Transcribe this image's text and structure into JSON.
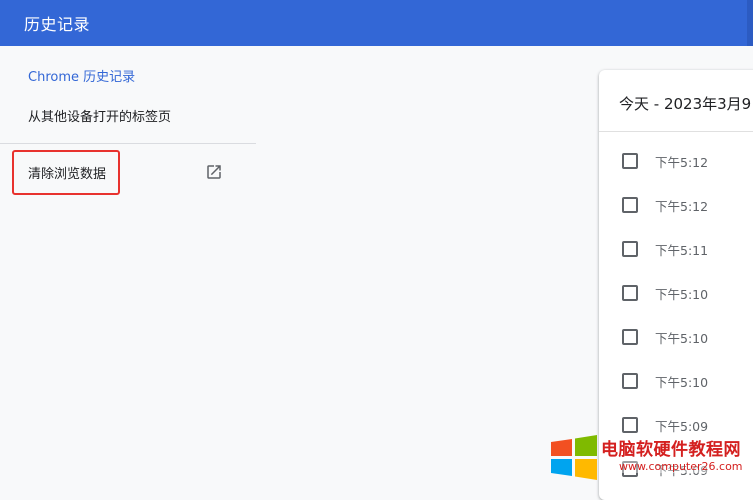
{
  "header": {
    "title": "历史记录"
  },
  "sidebar": {
    "items": [
      {
        "label": "Chrome 历史记录"
      },
      {
        "label": "从其他设备打开的标签页"
      },
      {
        "label": "清除浏览数据"
      }
    ]
  },
  "history": {
    "date_header": "今天 - 2023年3月9",
    "entries": [
      {
        "time": "下午5:12"
      },
      {
        "time": "下午5:12"
      },
      {
        "time": "下午5:11"
      },
      {
        "time": "下午5:10"
      },
      {
        "time": "下午5:10"
      },
      {
        "time": "下午5:10"
      },
      {
        "time": "下午5:09"
      },
      {
        "time": "下午5:09"
      }
    ]
  },
  "watermark": {
    "title": "电脑软硬件教程网",
    "url": "www.computer26.com"
  },
  "colors": {
    "accent": "#3367d6",
    "highlight_box": "#e8322e",
    "watermark": "#d4201f"
  }
}
